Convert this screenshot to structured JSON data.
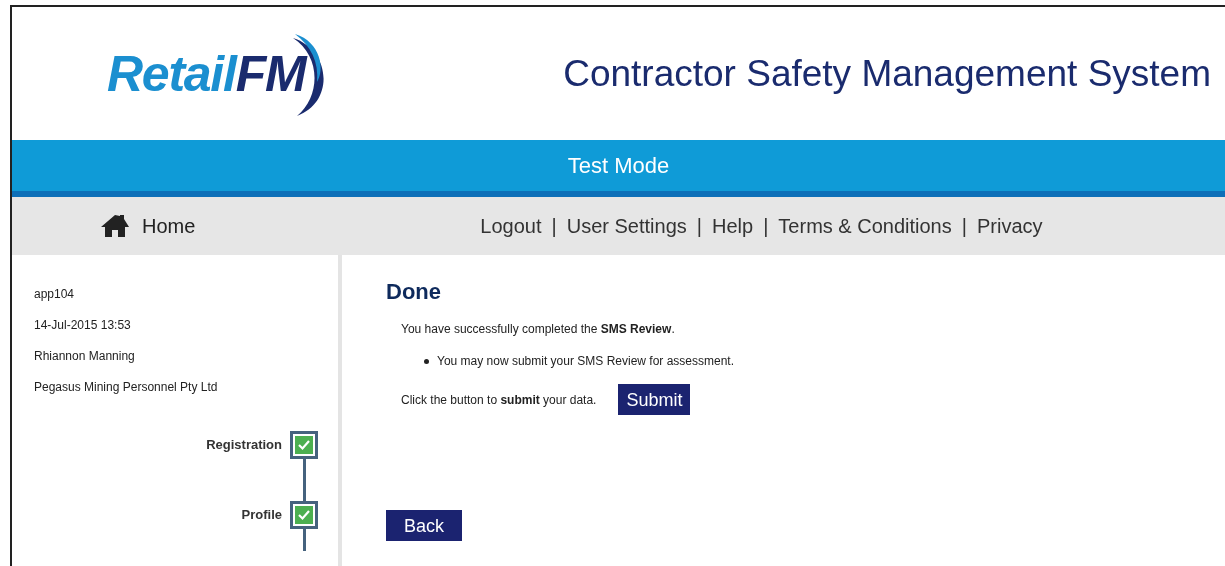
{
  "logo": {
    "part_1": "Retail",
    "part_2": "FM"
  },
  "header": {
    "title": "Contractor Safety Management System"
  },
  "mode_bar": {
    "label": "Test Mode"
  },
  "nav": {
    "home": "Home",
    "separator": "|",
    "links": [
      "Logout",
      "User Settings",
      "Help",
      "Terms & Conditions",
      "Privacy"
    ]
  },
  "sidebar": {
    "info": [
      "app104",
      "14-Jul-2015 13:53",
      "Rhiannon Manning",
      "Pegasus Mining Personnel Pty Ltd"
    ],
    "steps": [
      {
        "label": "Registration",
        "checked": true
      },
      {
        "label": "Profile",
        "checked": true
      }
    ]
  },
  "main": {
    "heading": "Done",
    "message": "You have successfully completed the **SMS Review**.",
    "bullets": [
      "You may now submit your SMS Review for assessment."
    ],
    "prompt": "Click the button to **submit** your data.",
    "submit_button": "Submit",
    "back_button": "Back"
  }
}
